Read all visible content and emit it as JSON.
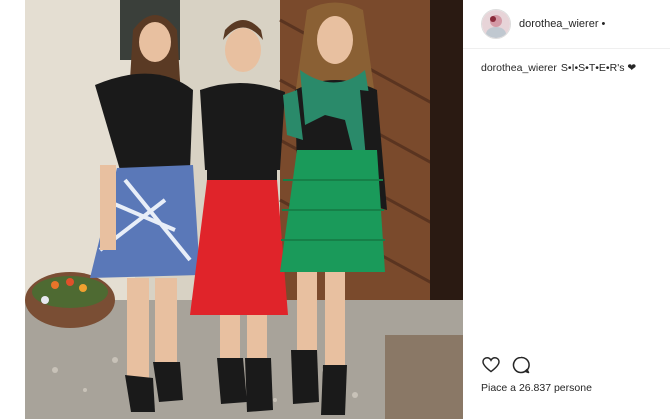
{
  "post": {
    "username": "dorothea_wierer",
    "dot": "•",
    "caption_user": "dorothea_wierer",
    "caption_text": "S•I•S•T•E•R's ❤",
    "likes_text": "Piace a 26.837 persone"
  },
  "icons": [
    "avatar",
    "heart-icon",
    "comment-icon"
  ],
  "colors": {
    "text": "#262626",
    "border": "#efefef"
  }
}
